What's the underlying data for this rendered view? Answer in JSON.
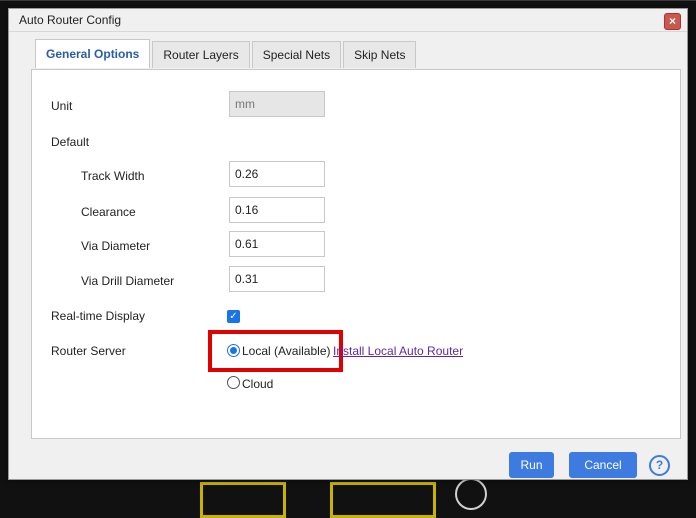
{
  "dialog": {
    "title": "Auto Router Config",
    "close_icon": "close-icon"
  },
  "tabs": [
    {
      "label": "General Options",
      "active": true
    },
    {
      "label": "Router Layers",
      "active": false
    },
    {
      "label": "Special Nets",
      "active": false
    },
    {
      "label": "Skip Nets",
      "active": false
    }
  ],
  "form": {
    "unit": {
      "label": "Unit",
      "value": "mm"
    },
    "default_label": "Default",
    "track_width": {
      "label": "Track Width",
      "value": "0.26"
    },
    "clearance": {
      "label": "Clearance",
      "value": "0.16"
    },
    "via_diameter": {
      "label": "Via Diameter",
      "value": "0.61"
    },
    "via_drill_diameter": {
      "label": "Via Drill Diameter",
      "value": "0.31"
    },
    "realtime_display": {
      "label": "Real-time Display",
      "checked": true
    },
    "router_server": {
      "label": "Router Server",
      "local_option": "Local (Available)",
      "install_link": "Install Local Auto Router",
      "cloud_option": "Cloud",
      "selected": "local"
    }
  },
  "footer": {
    "run_label": "Run",
    "cancel_label": "Cancel",
    "help_icon": "help-icon"
  },
  "colors": {
    "accent": "#3d7be0",
    "highlight": "#e00000",
    "link": "#5b2aa8"
  }
}
